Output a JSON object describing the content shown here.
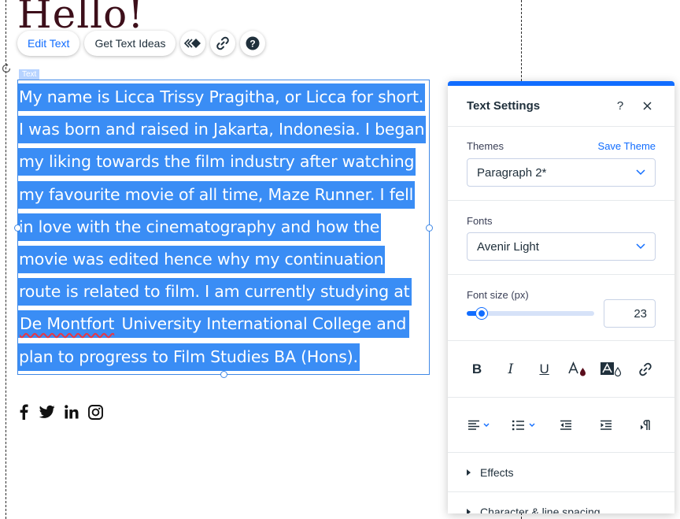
{
  "canvas": {
    "heading": "Hello!",
    "element_tag": "Text",
    "paragraph_lines": [
      "My name is Licca Trissy Pragitha, or Licca for short.",
      "I was born and raised in Jakarta, Indonesia. I began",
      "my liking towards the film industry after watching",
      "my favourite movie of all time, Maze Runner. I fell",
      "in love with the cinematography and how the",
      "movie was edited hence why my continuation",
      "route is related to film. I am currently studying at"
    ],
    "line8_misspelled": "De Montfort",
    "line8_rest": " University International College and",
    "line9": "plan to progress to Film Studies BA (Hons).",
    "social_icons": [
      "facebook-icon",
      "twitter-icon",
      "linkedin-icon",
      "instagram-icon"
    ]
  },
  "toolbar": {
    "edit_text": "Edit Text",
    "get_text_ideas": "Get Text Ideas"
  },
  "panel": {
    "title": "Text Settings",
    "help": "?",
    "themes_label": "Themes",
    "save_theme": "Save Theme",
    "theme_value": "Paragraph 2*",
    "fonts_label": "Fonts",
    "font_value": "Avenir Light",
    "font_size_label": "Font size (px)",
    "font_size_value": "23",
    "font_size_fraction": 0.12,
    "effects": "Effects",
    "character_spacing": "Character & line spacing"
  },
  "colors": {
    "accent": "#116dff",
    "selection": "#3a8df5",
    "heading": "#3d0f1a"
  }
}
